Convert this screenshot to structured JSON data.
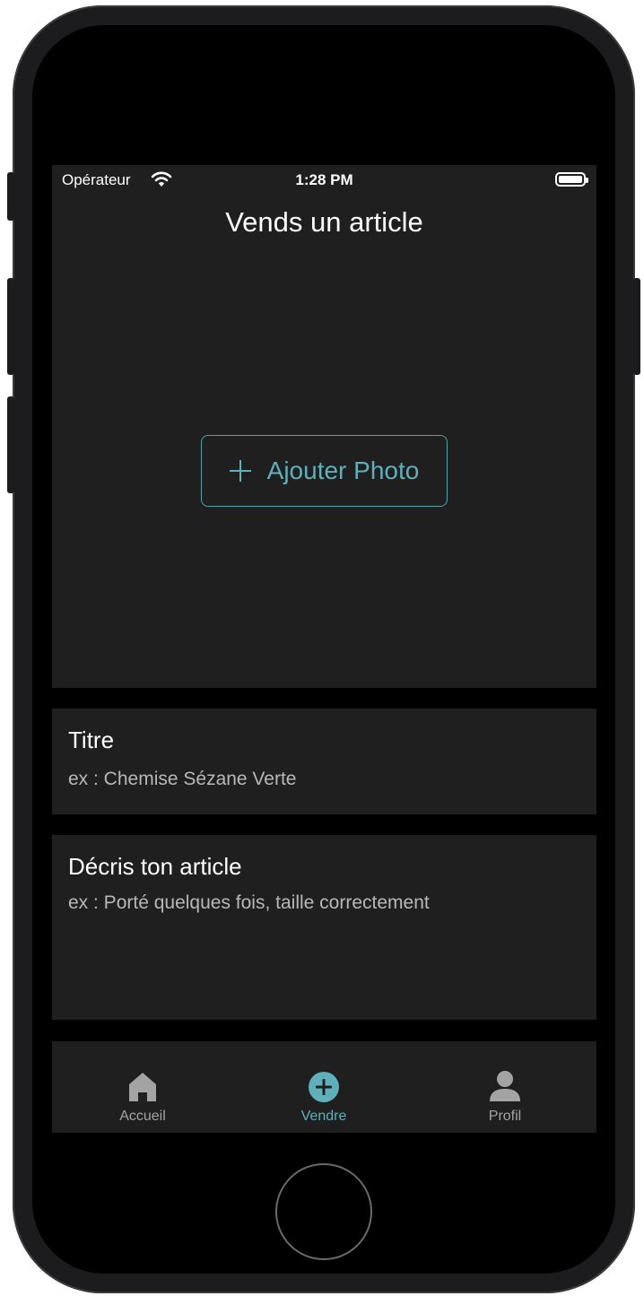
{
  "status_bar": {
    "carrier": "Opérateur",
    "time": "1:28 PM"
  },
  "header": {
    "title": "Vends un article"
  },
  "photo": {
    "add_label": "Ajouter Photo"
  },
  "fields": {
    "title": {
      "label": "Titre",
      "placeholder": "ex : Chemise Sézane Verte"
    },
    "description": {
      "label": "Décris ton article",
      "placeholder": "ex : Porté quelques fois, taille correctement"
    }
  },
  "tab_bar": {
    "items": [
      {
        "label": "Accueil",
        "icon": "home-icon"
      },
      {
        "label": "Vendre",
        "icon": "plus-circle-icon"
      },
      {
        "label": "Profil",
        "icon": "person-icon"
      }
    ],
    "selected": "Vendre"
  },
  "colors": {
    "accent": "#5fb0ba",
    "surface": "#1f1f1f",
    "inactive": "#a3a3a3"
  }
}
